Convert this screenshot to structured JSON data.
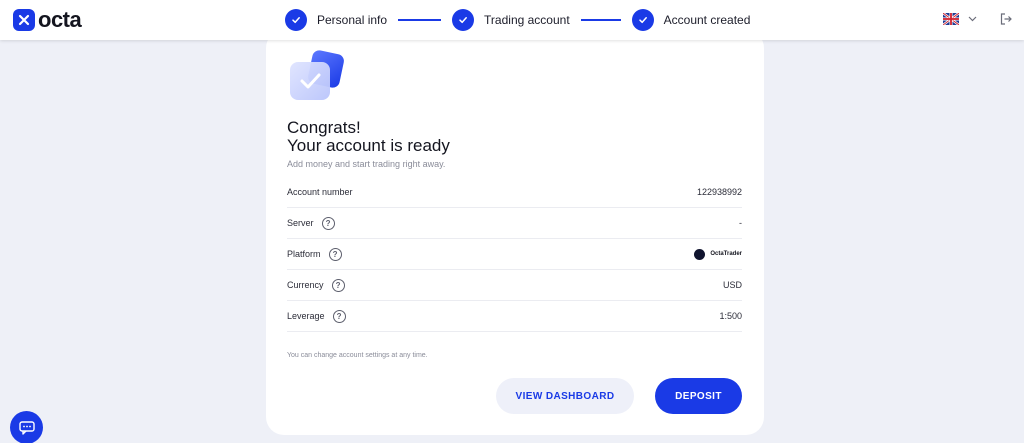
{
  "brand": {
    "name": "octa",
    "color": "#1a3ae6"
  },
  "stepper": {
    "steps": [
      {
        "label": "Personal info",
        "icon": "check-icon"
      },
      {
        "label": "Trading account",
        "icon": "check-icon"
      },
      {
        "label": "Account created",
        "icon": "check-icon"
      }
    ]
  },
  "header": {
    "language_icon": "uk-flag-icon",
    "logout_icon": "logout-icon"
  },
  "card": {
    "title_line1": "Congrats!",
    "title_line2": "Your account is ready",
    "subtitle": "Add money and start trading right away.",
    "rows": [
      {
        "label": "Account number",
        "value": "122938992",
        "help": false
      },
      {
        "label": "Server",
        "value": "-",
        "help": true
      },
      {
        "label": "Platform",
        "value": "OctaTrader",
        "help": true
      },
      {
        "label": "Currency",
        "value": "USD",
        "help": true
      },
      {
        "label": "Leverage",
        "value": "1:500",
        "help": true
      }
    ],
    "note": "You can change account settings at any time.",
    "dashboard_label": "VIEW DASHBOARD",
    "deposit_label": "DEPOSIT"
  },
  "help_glyph": "?",
  "chat": {
    "icon": "chat-icon"
  }
}
